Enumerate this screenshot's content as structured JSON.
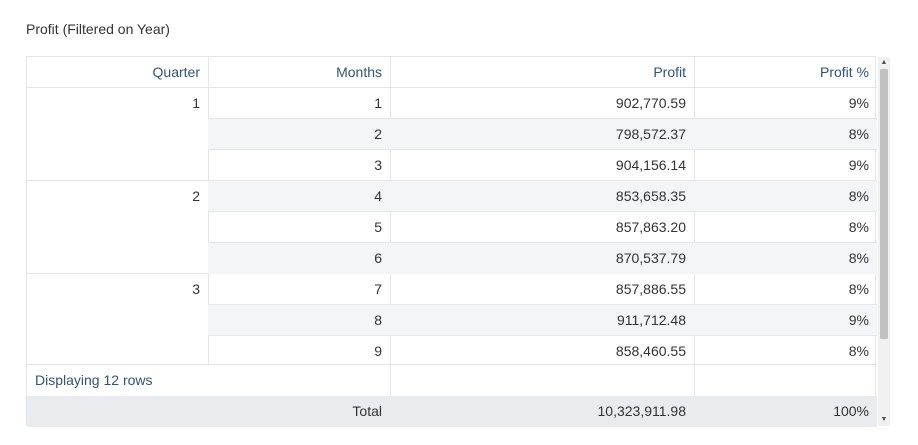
{
  "title": "Profit (Filtered on Year)",
  "columns": {
    "quarter": "Quarter",
    "months": "Months",
    "profit": "Profit",
    "profit_pct": "Profit %"
  },
  "rows": [
    {
      "month": "1",
      "profit": "902,770.59",
      "pct": "9%"
    },
    {
      "month": "2",
      "profit": "798,572.37",
      "pct": "8%"
    },
    {
      "month": "3",
      "profit": "904,156.14",
      "pct": "9%"
    },
    {
      "month": "4",
      "profit": "853,658.35",
      "pct": "8%"
    },
    {
      "month": "5",
      "profit": "857,863.20",
      "pct": "8%"
    },
    {
      "month": "6",
      "profit": "870,537.79",
      "pct": "8%"
    },
    {
      "month": "7",
      "profit": "857,886.55",
      "pct": "8%"
    },
    {
      "month": "8",
      "profit": "911,712.48",
      "pct": "9%"
    },
    {
      "month": "9",
      "profit": "858,460.55",
      "pct": "8%"
    }
  ],
  "quarters": [
    "1",
    "2",
    "3"
  ],
  "footer": {
    "info": "Displaying 12 rows"
  },
  "total": {
    "label": "Total",
    "profit": "10,323,911.98",
    "pct": "100%"
  },
  "scrollbar": {
    "up_icon": "triangle-up",
    "down_icon": "triangle-down"
  }
}
